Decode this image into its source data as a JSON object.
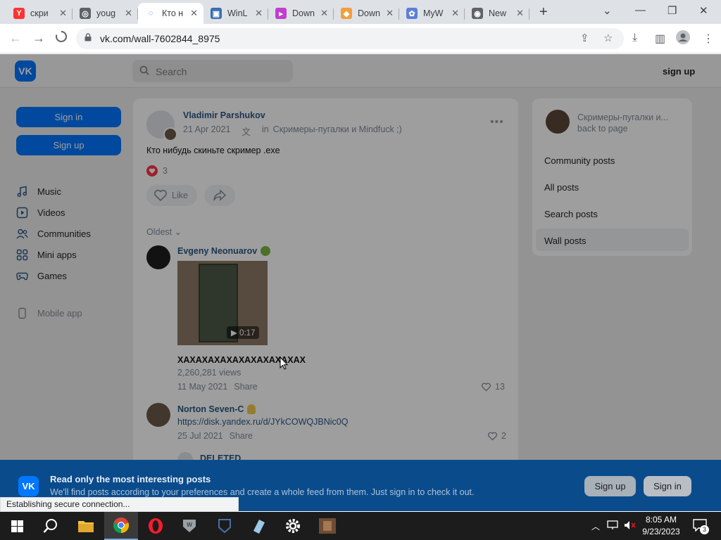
{
  "browser": {
    "tabs": [
      {
        "title": "скри",
        "favicon": "yandex-icon",
        "color": "#ff3333",
        "glyph": "Y"
      },
      {
        "title": "youg",
        "favicon": "globe-icon",
        "color": "#5f6368",
        "glyph": "◎"
      },
      {
        "title": "Кто н",
        "favicon": "loading-spinner-icon",
        "color": "#1a73e8",
        "glyph": "◌",
        "active": true
      },
      {
        "title": "WinL",
        "favicon": "winlauncher-icon",
        "color": "#3a6fb0",
        "glyph": "▣"
      },
      {
        "title": "Down",
        "favicon": "download-app-icon",
        "color": "#c03fd0",
        "glyph": "▸"
      },
      {
        "title": "Down",
        "favicon": "download-site-icon",
        "color": "#f29f3a",
        "glyph": "◆"
      },
      {
        "title": "MyW",
        "favicon": "myw-icon",
        "color": "#5a7fd6",
        "glyph": "✿"
      },
      {
        "title": "New",
        "favicon": "chrome-icon",
        "color": "#5f6368",
        "glyph": "◉"
      }
    ],
    "url": "vk.com/wall-7602844_8975",
    "status": "Establishing secure connection..."
  },
  "vk": {
    "search_placeholder": "Search",
    "header_signup": "sign up",
    "left": {
      "sign_in": "Sign in",
      "sign_up": "Sign up",
      "nav": [
        {
          "label": "Music",
          "icon": "music-icon"
        },
        {
          "label": "Videos",
          "icon": "video-icon"
        },
        {
          "label": "Communities",
          "icon": "communities-icon"
        },
        {
          "label": "Mini apps",
          "icon": "mini-apps-icon"
        },
        {
          "label": "Games",
          "icon": "games-icon"
        }
      ],
      "mobile_app": "Mobile app"
    },
    "post": {
      "author": "Vladimir Parshukov",
      "date": "21 Apr 2021",
      "in_label": "in",
      "community": "Скримеры-пугалки и Mindfuck ;)",
      "text": "Кто нибудь скиньте скример .exe",
      "likes": "3",
      "like_label": "Like"
    },
    "comments_sort": "Oldest",
    "comments": [
      {
        "author": "Evgeny Neonuarov",
        "video_duration": "0:17",
        "video_title": "ХАХАХАХАХАХАХАХАХАХАХ",
        "video_views": "2,260,281 views",
        "date": "11 May 2021",
        "share": "Share",
        "likes": "13"
      },
      {
        "author": "Norton Seven-C",
        "link": "https://disk.yandex.ru/d/JYkCOWQJBNic0Q",
        "date": "25 Jul 2021",
        "share": "Share",
        "likes": "2"
      },
      {
        "author": "DELETED"
      }
    ],
    "side": {
      "community": "Скримеры-пугалки и...",
      "back": "back to page",
      "links": [
        "Community posts",
        "All posts",
        "Search posts",
        "Wall posts"
      ]
    },
    "banner": {
      "title": "Read only the most interesting posts",
      "text": "We'll find posts according to your preferences and create a whole feed from them. Just sign in to check it out.",
      "sign_up": "Sign up",
      "sign_in": "Sign in"
    }
  },
  "taskbar": {
    "apps": [
      "start-icon",
      "search-icon",
      "file-explorer-icon",
      "chrome-icon",
      "opera-icon",
      "wot-icon",
      "warships-icon",
      "notepad-icon",
      "settings-icon",
      "game-icon"
    ],
    "time": "8:05 AM",
    "date": "9/23/2023",
    "notifications": "3"
  }
}
